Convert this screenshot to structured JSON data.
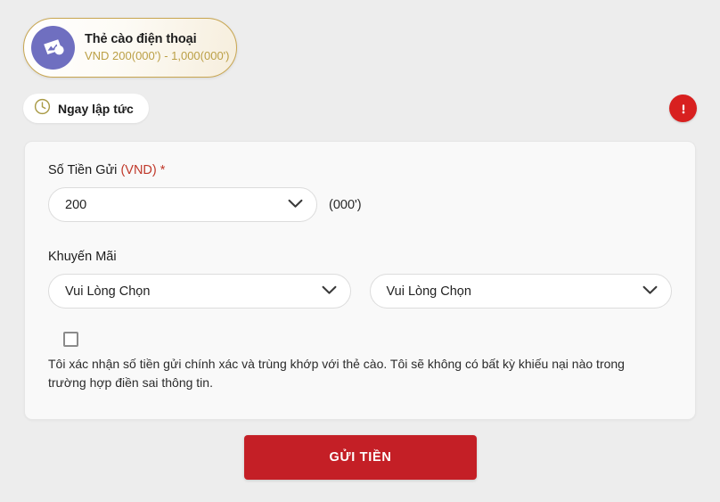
{
  "method_card": {
    "icon": "scratch-card-icon",
    "title": "Thẻ cào điện thoại",
    "range": "VND 200(000') - 1,000(000')",
    "accent_color": "#c8a651",
    "icon_bg": "#6f6fc0"
  },
  "instant_badge": {
    "icon": "clock-icon",
    "label": "Ngay lập tức"
  },
  "alert": {
    "icon": "alert-exclamation-icon",
    "color": "#d8201f"
  },
  "form": {
    "amount": {
      "label_text": "Số Tiền Gửi ",
      "label_unit": "(VND)",
      "label_required": "*",
      "value": "200",
      "suffix": "(000')",
      "chevron_icon": "chevron-down-icon"
    },
    "promotion": {
      "label": "Khuyến Mãi",
      "primary_value": "Vui Lòng Chọn",
      "secondary_value": "Vui Lòng Chọn",
      "chevron_icon": "chevron-down-icon"
    },
    "consent": {
      "checked": false,
      "text": "Tôi xác nhận số tiền gửi chính xác và trùng khớp với thẻ cào. Tôi sẽ không có bất kỳ khiếu nại nào trong trường hợp điền sai thông tin."
    }
  },
  "submit": {
    "label": "GỬI TIỀN",
    "color": "#c41f26"
  }
}
